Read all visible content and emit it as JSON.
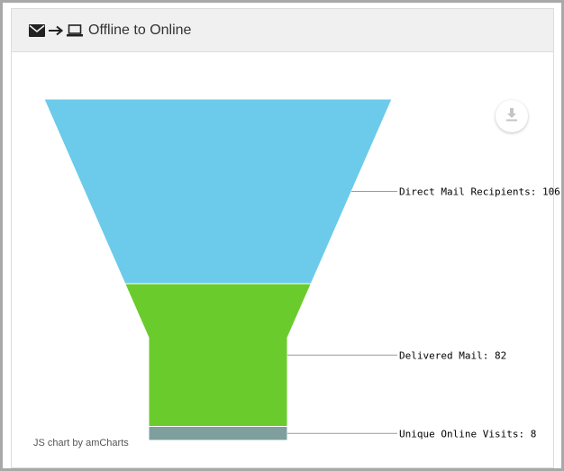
{
  "header": {
    "title": "Offline to Online",
    "icons": [
      "envelope-icon",
      "arrow-right-icon",
      "laptop-icon"
    ]
  },
  "export": {
    "icon": "download-icon"
  },
  "credit": {
    "text": "JS chart by amCharts"
  },
  "chart_data": {
    "type": "funnel",
    "title": "Offline to Online",
    "categories": [
      "Direct Mail Recipients",
      "Delivered Mail",
      "Unique Online Visits"
    ],
    "values": [
      106,
      82,
      8
    ],
    "labels": [
      "Direct Mail Recipients: 106",
      "Delivered Mail: 82",
      "Unique Online Visits: 8"
    ],
    "colors": [
      "#6ccaea",
      "#6acb2d",
      "#7f9f9f"
    ],
    "label_line_color": "#999999"
  }
}
